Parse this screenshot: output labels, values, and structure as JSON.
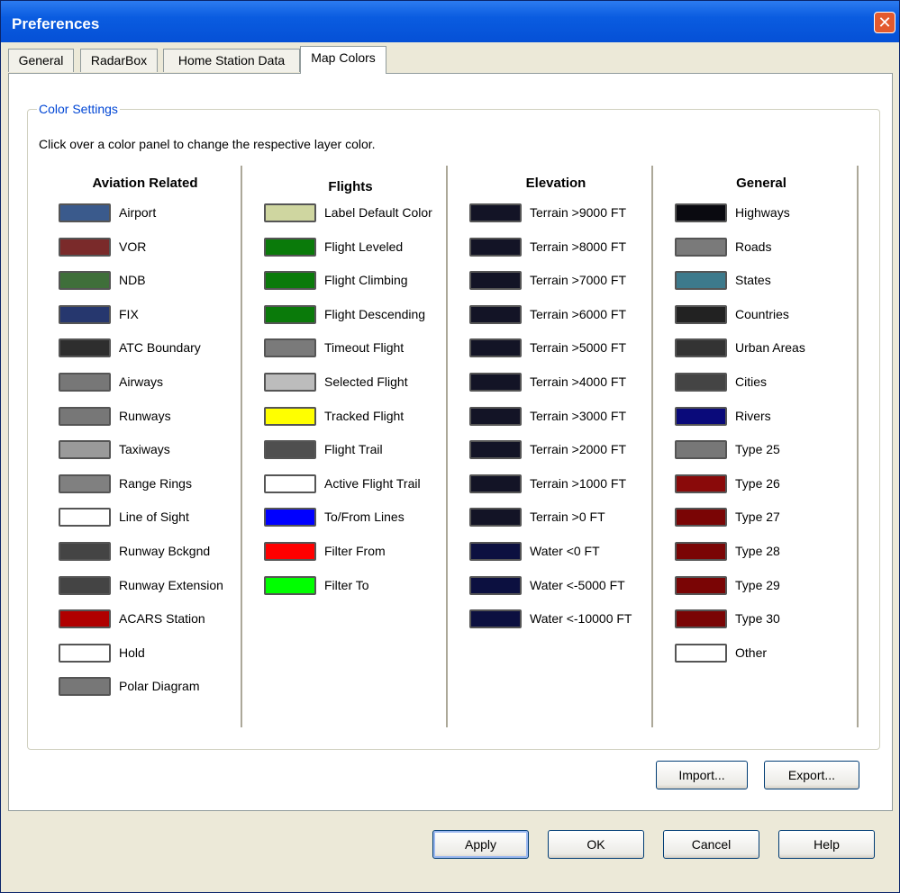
{
  "window": {
    "title": "Preferences"
  },
  "tabs": [
    {
      "label": "General"
    },
    {
      "label": "RadarBox"
    },
    {
      "label": "Home Station Data"
    },
    {
      "label": "Map Colors"
    }
  ],
  "group": {
    "title": "Color Settings",
    "instruction": "Click over a color panel to change the respective layer color."
  },
  "columns": [
    {
      "header": "Aviation Related",
      "items": [
        {
          "label": "Airport",
          "color": "#3a5a8c"
        },
        {
          "label": "VOR",
          "color": "#7a2a2a"
        },
        {
          "label": "NDB",
          "color": "#3f6f3a"
        },
        {
          "label": "FIX",
          "color": "#26376e"
        },
        {
          "label": "ATC Boundary",
          "color": "#2e2e2e"
        },
        {
          "label": "Airways",
          "color": "#777777"
        },
        {
          "label": "Runways",
          "color": "#777777"
        },
        {
          "label": "Taxiways",
          "color": "#9a9a9a"
        },
        {
          "label": "Range Rings",
          "color": "#808080"
        },
        {
          "label": "Line of Sight",
          "color": "#ffffff"
        },
        {
          "label": "Runway Bckgnd",
          "color": "#444444"
        },
        {
          "label": "Runway Extension",
          "color": "#444444"
        },
        {
          "label": "ACARS Station",
          "color": "#b00000"
        },
        {
          "label": "Hold",
          "color": "#ffffff"
        },
        {
          "label": "Polar Diagram",
          "color": "#777777"
        }
      ]
    },
    {
      "header": "Flights",
      "items": [
        {
          "label": "Label Default Color",
          "color": "#cfd6a0"
        },
        {
          "label": "Flight Leveled",
          "color": "#0a7a0a"
        },
        {
          "label": "Flight Climbing",
          "color": "#0a7a0a"
        },
        {
          "label": "Flight Descending",
          "color": "#0a7a0a"
        },
        {
          "label": "Timeout Flight",
          "color": "#7a7a7a"
        },
        {
          "label": "Selected Flight",
          "color": "#bcbcbc"
        },
        {
          "label": "Tracked Flight",
          "color": "#ffff00"
        },
        {
          "label": "Flight Trail",
          "color": "#4f4f4f"
        },
        {
          "label": "Active Flight Trail",
          "color": "#ffffff"
        },
        {
          "label": "To/From Lines",
          "color": "#0000ff"
        },
        {
          "label": "Filter From",
          "color": "#ff0000"
        },
        {
          "label": "Filter To",
          "color": "#00ff00"
        }
      ]
    },
    {
      "header": "Elevation",
      "items": [
        {
          "label": "Terrain >9000 FT",
          "color": "#131426"
        },
        {
          "label": "Terrain >8000 FT",
          "color": "#131426"
        },
        {
          "label": "Terrain >7000 FT",
          "color": "#131426"
        },
        {
          "label": "Terrain >6000 FT",
          "color": "#131426"
        },
        {
          "label": "Terrain >5000 FT",
          "color": "#131426"
        },
        {
          "label": "Terrain >4000 FT",
          "color": "#131426"
        },
        {
          "label": "Terrain >3000 FT",
          "color": "#131426"
        },
        {
          "label": "Terrain >2000 FT",
          "color": "#131426"
        },
        {
          "label": "Terrain >1000 FT",
          "color": "#131426"
        },
        {
          "label": "Terrain >0 FT",
          "color": "#131426"
        },
        {
          "label": "Water <0 FT",
          "color": "#0c1040"
        },
        {
          "label": "Water <-5000 FT",
          "color": "#0c1040"
        },
        {
          "label": "Water <-10000 FT",
          "color": "#0c1040"
        }
      ]
    },
    {
      "header": "General",
      "items": [
        {
          "label": "Highways",
          "color": "#0a0a10"
        },
        {
          "label": "Roads",
          "color": "#7a7a7a"
        },
        {
          "label": "States",
          "color": "#3d7a8c"
        },
        {
          "label": "Countries",
          "color": "#222222"
        },
        {
          "label": "Urban Areas",
          "color": "#333333"
        },
        {
          "label": "Cities",
          "color": "#444444"
        },
        {
          "label": "Rivers",
          "color": "#0a0a7a"
        },
        {
          "label": "Type 25",
          "color": "#777777"
        },
        {
          "label": "Type 26",
          "color": "#8a0a0a"
        },
        {
          "label": "Type 27",
          "color": "#7a0505"
        },
        {
          "label": "Type 28",
          "color": "#7a0505"
        },
        {
          "label": "Type 29",
          "color": "#7a0505"
        },
        {
          "label": "Type 30",
          "color": "#7a0505"
        },
        {
          "label": "Other",
          "color": "#ffffff"
        }
      ]
    }
  ],
  "buttons": {
    "import": "Import...",
    "export": "Export...",
    "apply": "Apply",
    "ok": "OK",
    "cancel": "Cancel",
    "help": "Help"
  }
}
